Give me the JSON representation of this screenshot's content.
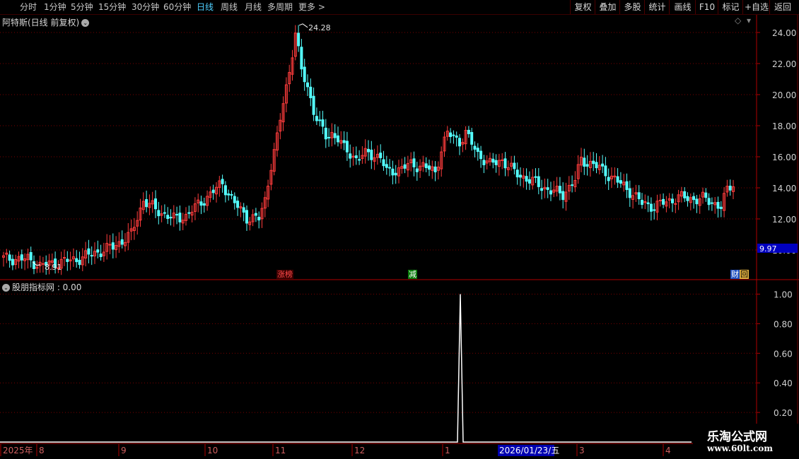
{
  "toolbar": {
    "left_items": [
      "分时",
      "1分钟",
      "5分钟",
      "15分钟",
      "30分钟",
      "60分钟",
      "日线",
      "周线",
      "月线",
      "多周期",
      "更多 >"
    ],
    "active_item": "日线",
    "right_items": [
      "复权",
      "叠加",
      "多股",
      "统计",
      "画线",
      "F10",
      "标记",
      "+自选",
      "返回"
    ]
  },
  "main_chart": {
    "title": "阿特斯(日线 前复权)",
    "high_label": "24.28",
    "low_label": "8.91",
    "y_ticks": [
      "24.00",
      "22.00",
      "20.00",
      "18.00",
      "16.00",
      "14.00",
      "12.00",
      "10.00"
    ],
    "price_tag": "9.97",
    "event_tags": [
      "涨榜",
      "减",
      "财",
      "回"
    ]
  },
  "indicator": {
    "title": "股朋指标网 : 0.00",
    "y_ticks": [
      "1.00",
      "0.80",
      "0.60",
      "0.40",
      "0.20"
    ]
  },
  "time_axis": {
    "labels": [
      "2025年",
      "8",
      "9",
      "10",
      "11",
      "12",
      "1",
      "3",
      "4"
    ],
    "cursor_date": "2026/01/23/五"
  },
  "watermark": {
    "line1": "乐淘公式网",
    "line2": "www.60lt.com"
  },
  "colors": {
    "up": "#ff3c3c",
    "down": "#54ffff",
    "grid": "#7a0000",
    "axis": "#b00000",
    "active_tab": "#4fd0ff"
  },
  "chart_data": {
    "type": "candlestick",
    "ylim": [
      10,
      24.8
    ],
    "close_anchors": [
      [
        0,
        9.45
      ],
      [
        8,
        9.4
      ],
      [
        12,
        9.0
      ],
      [
        18,
        9.2
      ],
      [
        24,
        9.4
      ],
      [
        30,
        9.8
      ],
      [
        36,
        10.2
      ],
      [
        42,
        11.0
      ],
      [
        46,
        13.2
      ],
      [
        50,
        12.6
      ],
      [
        56,
        12.0
      ],
      [
        60,
        12.2
      ],
      [
        64,
        12.9
      ],
      [
        68,
        13.6
      ],
      [
        72,
        14.3
      ],
      [
        76,
        13.0
      ],
      [
        80,
        12.1
      ],
      [
        84,
        12.0
      ],
      [
        86,
        13.2
      ],
      [
        88,
        15.5
      ],
      [
        90,
        17.2
      ],
      [
        92,
        19.5
      ],
      [
        94,
        21.5
      ],
      [
        96,
        24.0
      ],
      [
        98,
        21.5
      ],
      [
        100,
        20.5
      ],
      [
        102,
        19.0
      ],
      [
        104,
        18.0
      ],
      [
        106,
        17.3
      ],
      [
        108,
        17.5
      ],
      [
        110,
        17.2
      ],
      [
        112,
        16.5
      ],
      [
        116,
        15.9
      ],
      [
        120,
        16.2
      ],
      [
        124,
        16.0
      ],
      [
        126,
        15.0
      ],
      [
        130,
        15.2
      ],
      [
        134,
        15.5
      ],
      [
        138,
        15.4
      ],
      [
        142,
        15.0
      ],
      [
        144,
        16.5
      ],
      [
        146,
        17.5
      ],
      [
        150,
        17.0
      ],
      [
        152,
        17.5
      ],
      [
        156,
        16.2
      ],
      [
        160,
        15.5
      ],
      [
        164,
        15.8
      ],
      [
        168,
        15.0
      ],
      [
        172,
        14.6
      ],
      [
        176,
        14.2
      ],
      [
        180,
        13.8
      ],
      [
        184,
        13.6
      ],
      [
        188,
        14.5
      ],
      [
        190,
        15.8
      ],
      [
        194,
        15.5
      ],
      [
        198,
        15.0
      ],
      [
        202,
        14.4
      ],
      [
        206,
        13.8
      ],
      [
        210,
        13.0
      ],
      [
        214,
        12.8
      ],
      [
        218,
        13.1
      ],
      [
        222,
        13.4
      ],
      [
        226,
        13.3
      ],
      [
        230,
        13.3
      ],
      [
        234,
        13.0
      ],
      [
        236,
        12.8
      ],
      [
        238,
        13.8
      ],
      [
        240,
        14.3
      ]
    ],
    "high": {
      "index": 97,
      "value": 24.28
    },
    "low": {
      "index": 10,
      "value": 8.91
    },
    "indicator_spike": {
      "index": 150,
      "value": 1.0
    },
    "indicator_ylim": [
      0,
      1.05
    ]
  }
}
